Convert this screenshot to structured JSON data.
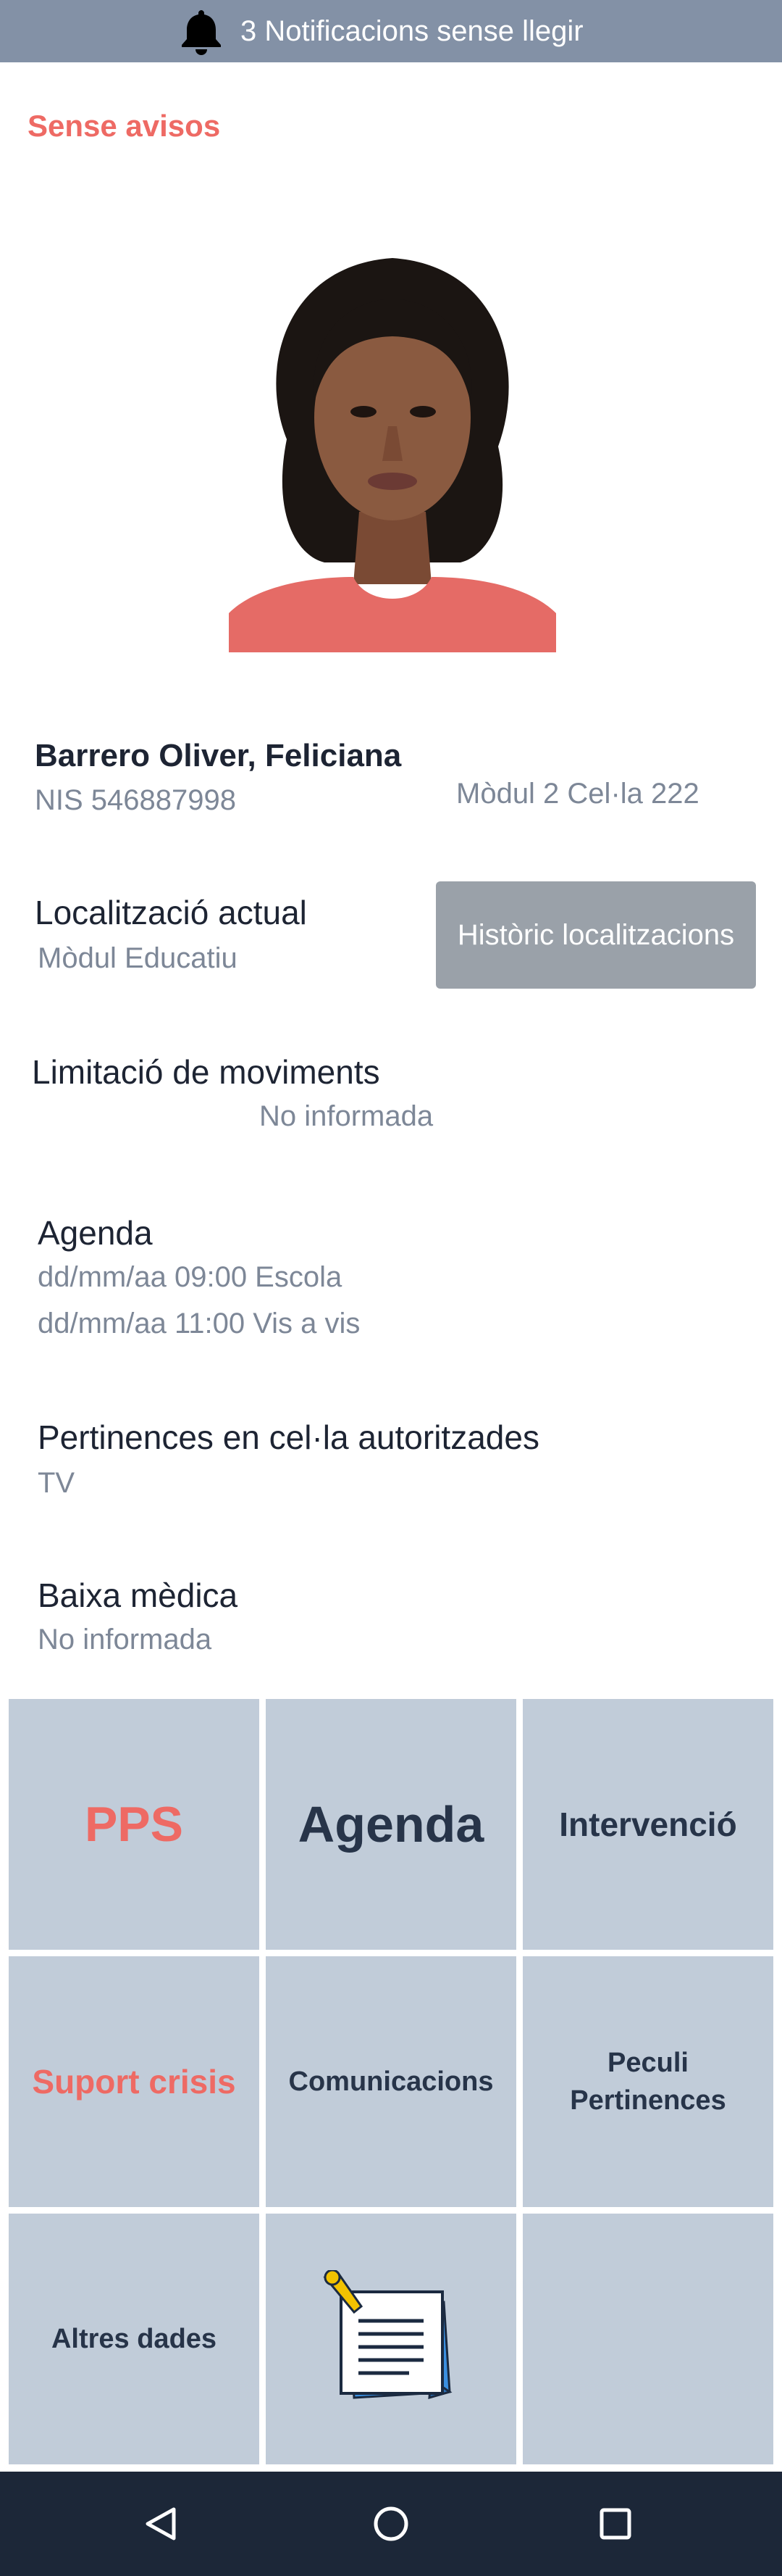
{
  "notifications": {
    "text": "3 Notificacions sense llegir",
    "icon": "bell-icon"
  },
  "alerts": {
    "label": "Sense avisos",
    "color": "#ee6a64"
  },
  "profile": {
    "name": "Barrero Oliver, Feliciana",
    "nis": "NIS 546887998",
    "cell": "Mòdul 2 Cel·la 222"
  },
  "location": {
    "title": "Localització actual",
    "value": "Mòdul Educatiu",
    "history_button": "Històric localitzacions"
  },
  "movement": {
    "title": "Limitació de moviments",
    "value": "No informada"
  },
  "agenda": {
    "title": "Agenda",
    "items": [
      "dd/mm/aa 09:00 Escola",
      "dd/mm/aa 11:00 Vis a vis"
    ]
  },
  "belongings": {
    "title": "Pertinences en cel·la autoritzades",
    "value": "TV"
  },
  "medical_leave": {
    "title": "Baixa mèdica",
    "value": "No informada"
  },
  "tiles": {
    "pps": "PPS",
    "agenda": "Agenda",
    "intervencio": "Intervenció",
    "suport_crisis": "Suport crisis",
    "comunicacions": "Comunicacions",
    "peculi_line1": "Peculi",
    "peculi_line2": "Pertinences",
    "altres_dades": "Altres dades",
    "notes_icon": "notepad-icon"
  },
  "nav": {
    "back": "back-icon",
    "home": "home-icon",
    "recents": "recents-icon"
  },
  "colors": {
    "topbar": "#8391a6",
    "accent_red": "#ee6a64",
    "tile_bg": "#c1ccd9",
    "button_gray": "#9aa1a9",
    "navbar": "#1c2738"
  }
}
